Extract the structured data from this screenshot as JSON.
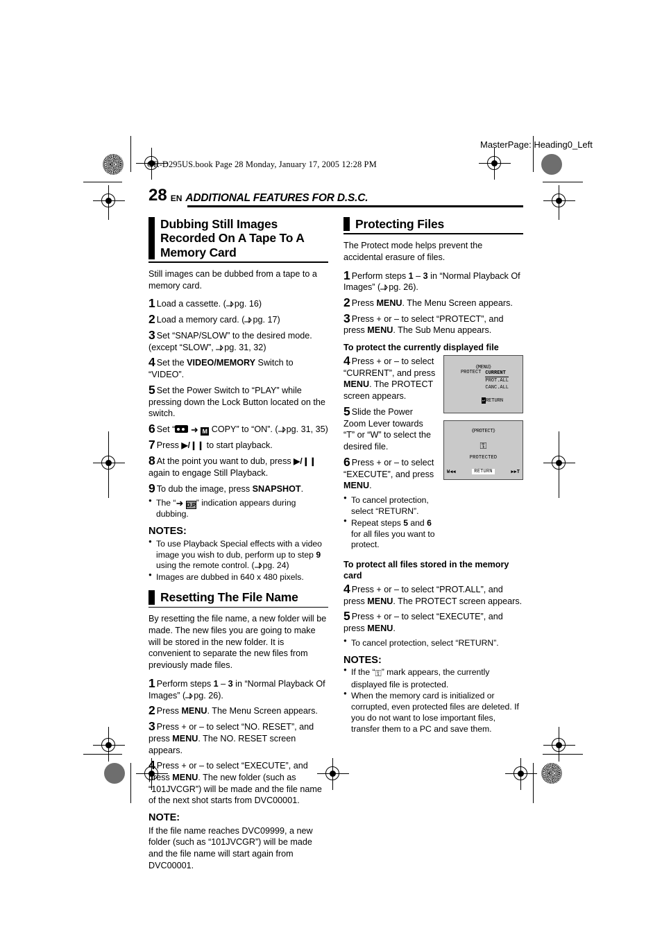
{
  "printer_slug": "GR-D295US.book  Page 28  Monday, January 17, 2005  12:28 PM",
  "masterpage": "MasterPage: Heading0_Left",
  "page_header": {
    "number": "28",
    "lang": "EN",
    "title": "ADDITIONAL FEATURES FOR D.S.C."
  },
  "left_column": {
    "section1": {
      "heading": "Dubbing Still Images Recorded On A Tape To A Memory Card",
      "intro": "Still images can be dubbed from a tape to a memory card.",
      "steps": [
        {
          "n": "1",
          "text": "Load a cassette. (",
          "ref": "pg. 16",
          "tail": ")"
        },
        {
          "n": "2",
          "text": "Load a memory card. (",
          "ref": "pg. 17",
          "tail": ")"
        },
        {
          "n": "3",
          "text": "Set “SNAP/SLOW” to the desired mode. (except “SLOW”, ",
          "ref": "pg. 31, 32",
          "tail": ")"
        },
        {
          "n": "4",
          "text_a": "Set the ",
          "bold": "VIDEO/MEMORY",
          "text_b": " Switch to “VIDEO”."
        },
        {
          "n": "5",
          "text": "Set the Power Switch to “PLAY” while pressing down the Lock Button located on the switch."
        },
        {
          "n": "6",
          "text_a": "Set “",
          "icon_tape": "tape-icon",
          "icon_arrow": "➜",
          "icon_m": "M",
          "text_b": " COPY” to “ON”. (",
          "ref": "pg. 31, 35",
          "tail": ")"
        },
        {
          "n": "7",
          "text_a": "Press ",
          "play": "▶/❙❙",
          "text_b": " to start playback."
        },
        {
          "n": "8",
          "text_a": "At the point you want to dub, press ",
          "play": "▶/❙❙",
          "text_b": " again to engage Still Playback."
        },
        {
          "n": "9",
          "text_a": "To dub the image, press ",
          "bold": "SNAPSHOT",
          "text_b": "."
        }
      ],
      "bullet_after_9": {
        "pre": "The “",
        "arrow": "➜",
        "box": "D.P.",
        "post": "” indication appears during dubbing."
      },
      "notes_label": "NOTES:",
      "notes": [
        {
          "a": "To use Playback Special effects with a video image you wish to dub, perform up to step ",
          "step": "9",
          "b": " using the remote control. (",
          "ref": "pg. 24",
          "tail": ")"
        },
        {
          "a": "Images are dubbed in 640 x 480 pixels."
        }
      ]
    },
    "section2": {
      "heading": "Resetting The File Name",
      "intro": "By resetting the file name, a new folder will be made. The new files you are going to make will be stored in the new folder. It is convenient to separate the new files from previously made files.",
      "steps": [
        {
          "n": "1",
          "a": "Perform steps ",
          "s1": "1",
          "dash": " – ",
          "s2": "3",
          "b": " in “Normal Playback Of Images” (",
          "ref": "pg. 26",
          "tail": ")."
        },
        {
          "n": "2",
          "a": "Press ",
          "bold": "MENU",
          "b": ". The Menu Screen appears."
        },
        {
          "n": "3",
          "a": "Press + or – to select “NO. RESET”, and press ",
          "bold": "MENU",
          "b": ". The NO. RESET screen appears."
        },
        {
          "n": "4",
          "a": "Press + or – to select “EXECUTE”, and press ",
          "bold": "MENU",
          "b": ". The new folder (such as “101JVCGR”) will be made and the file name of the next shot starts from DVC00001."
        }
      ],
      "note_label": "NOTE:",
      "note_text": "If the file name reaches DVC09999, a new folder (such as “101JVCGR”) will be made and the file name will start again from DVC00001."
    }
  },
  "right_column": {
    "section1": {
      "heading": "Protecting Files",
      "intro": "The Protect mode helps prevent the accidental erasure of files.",
      "steps": [
        {
          "n": "1",
          "a": "Perform steps ",
          "s1": "1",
          "dash": " – ",
          "s2": "3",
          "b": " in “Normal Playback Of Images” (",
          "ref": "pg. 26",
          "tail": ")."
        },
        {
          "n": "2",
          "a": "Press ",
          "bold": "MENU",
          "b": ". The Menu Screen appears."
        },
        {
          "n": "3",
          "a": "Press + or – to select “PROTECT”, and press ",
          "bold": "MENU",
          "b": ". The Sub Menu appears."
        }
      ],
      "subhead_current": "To protect the currently displayed file",
      "steps_current": [
        {
          "n": "4",
          "a": "Press + or – to select “CURRENT”, and press ",
          "bold": "MENU",
          "b": ". The PROTECT screen appears."
        },
        {
          "n": "5",
          "a": "Slide the Power Zoom Lever towards “T” or “W” to select the desired file."
        },
        {
          "n": "6",
          "a": "Press + or – to select “EXECUTE”, and press ",
          "bold": "MENU",
          "b": "."
        }
      ],
      "bullets_current": [
        {
          "a": "To cancel protection, select “RETURN”."
        },
        {
          "a": "Repeat steps ",
          "s1": "5",
          "mid": " and ",
          "s2": "6",
          "b": " for all files you want to protect."
        }
      ],
      "subhead_all": "To protect all files stored in the memory card",
      "steps_all": [
        {
          "n": "4",
          "a": "Press + or – to select “PROT.ALL”, and press ",
          "bold": "MENU",
          "b": ". The PROTECT screen appears."
        },
        {
          "n": "5",
          "a": "Press + or – to select “EXECUTE”, and press ",
          "bold": "MENU",
          "b": "."
        }
      ],
      "bullet_all": "To cancel protection, select “RETURN”.",
      "notes_label": "NOTES:",
      "notes": [
        {
          "pre": "If the “",
          "key": "⚿",
          "post": "” mark appears, the currently displayed file is protected."
        },
        {
          "pre": "When the memory card is initialized or corrupted, even protected files are deleted. If you do not want to lose important files, transfer them to a PC and save them."
        }
      ]
    },
    "lcd_menu": {
      "title": "《MENU》",
      "label": "PROTECT",
      "options": [
        "CURRENT",
        "PROT.ALL",
        "CANC.ALL"
      ],
      "selected": "CURRENT",
      "return_icon": "↵",
      "return_label": "RETURN"
    },
    "lcd_protect": {
      "title": "《PROTECT》",
      "key_icon": "⚿",
      "status": "PROTECTED",
      "left_control": "W◀◀",
      "center_control": "RETURN",
      "right_control": "▶▶T"
    }
  }
}
